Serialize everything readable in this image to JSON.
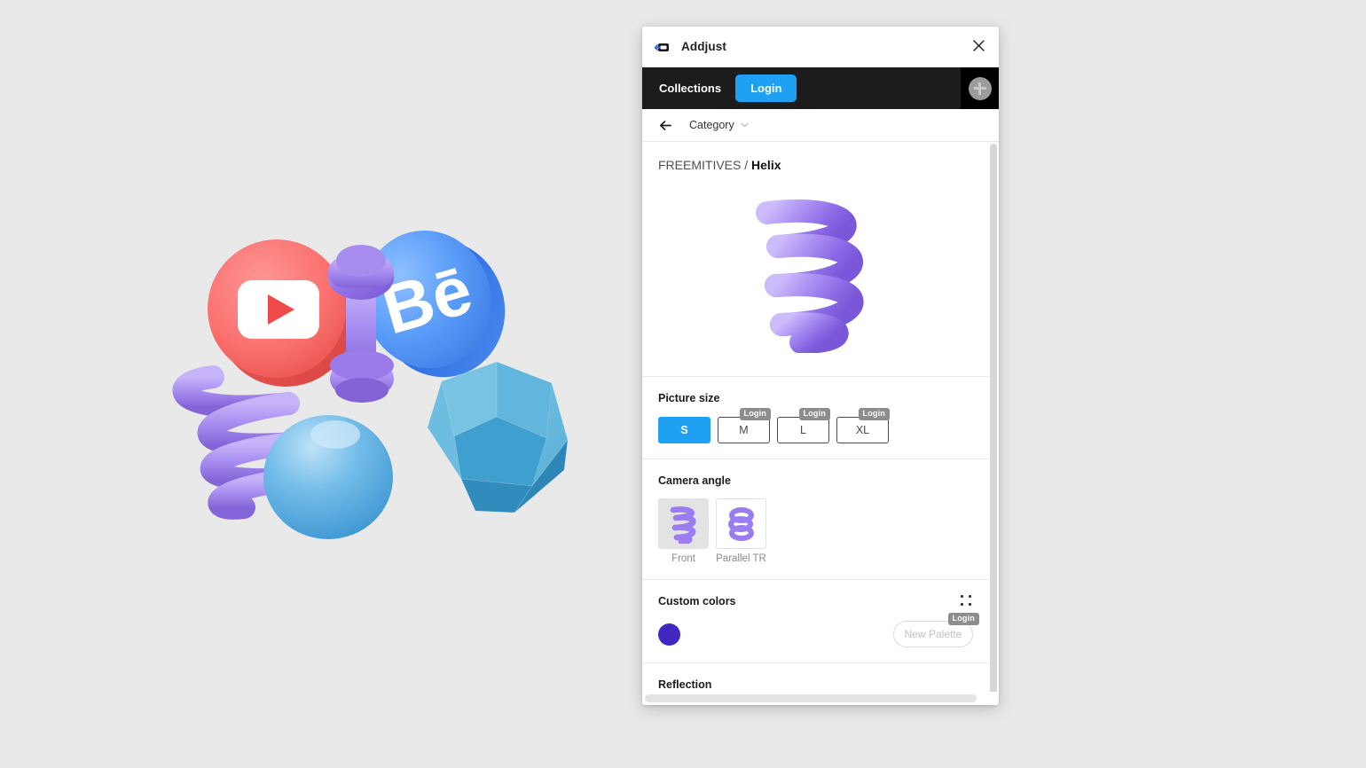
{
  "window": {
    "title": "Addjust",
    "logo_icon": "addjust-logo-icon",
    "close_icon": "close-icon"
  },
  "navbar": {
    "collections_label": "Collections",
    "login_label": "Login",
    "add_icon": "plus-circle-icon",
    "accent_color": "#1fa1f3",
    "background_color": "#1c1c1c"
  },
  "breadcrumb_bar": {
    "back_icon": "back-arrow-icon",
    "category_label": "Category",
    "chevron_icon": "chevron-down-icon"
  },
  "preview": {
    "collection_name": "FREEMITIVES",
    "separator": "/",
    "model_name": "Helix",
    "model_icon": "helix-3d-model"
  },
  "picture_size": {
    "title": "Picture size",
    "options": [
      {
        "label": "S",
        "selected": true,
        "locked": false,
        "badge": ""
      },
      {
        "label": "M",
        "selected": false,
        "locked": true,
        "badge": "Login"
      },
      {
        "label": "L",
        "selected": false,
        "locked": true,
        "badge": "Login"
      },
      {
        "label": "XL",
        "selected": false,
        "locked": true,
        "badge": "Login"
      }
    ]
  },
  "camera_angle": {
    "title": "Camera angle",
    "options": [
      {
        "label": "Front",
        "selected": true
      },
      {
        "label": "Parallel TR",
        "selected": false
      }
    ]
  },
  "custom_colors": {
    "title": "Custom colors",
    "drag_icon": "drag-handle-icon",
    "swatches": [
      {
        "color": "#4126c0",
        "name": "indigo"
      }
    ],
    "new_palette_label": "New Palette",
    "new_palette_badge": "Login"
  },
  "reflection": {
    "title": "Reflection"
  },
  "scrollbars": {
    "vertical_visible": true,
    "horizontal_visible": true
  },
  "background_art": {
    "objects": [
      {
        "name": "youtube-logo-3d",
        "color": "#f9716f"
      },
      {
        "name": "behance-logo-3d",
        "color": "#5a9cf8"
      },
      {
        "name": "dumbbell-3d",
        "color": "#8964e0"
      },
      {
        "name": "helix-spring-3d",
        "color": "#a48aef"
      },
      {
        "name": "sphere-3d",
        "color": "#62b4e8"
      },
      {
        "name": "dodecahedron-3d",
        "color": "#3f9fce"
      }
    ],
    "backdrop_color": "#e9e9e9"
  }
}
